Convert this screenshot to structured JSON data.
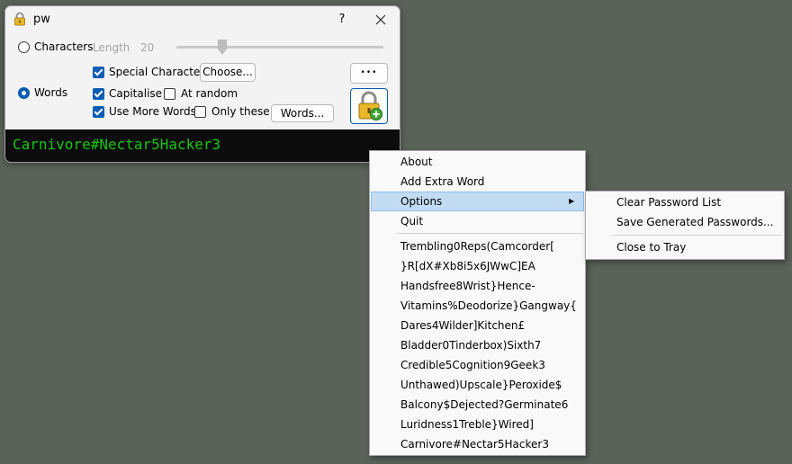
{
  "window": {
    "title": "pw",
    "help_label": "?",
    "close_label": "✕",
    "mode_characters": "Characters",
    "length_label": "Length",
    "length_value": "20",
    "special_chars": "Special Characters",
    "choose_button": "Choose...",
    "more_button": "•••",
    "mode_words": "Words",
    "capitalise": "Capitalise",
    "at_random": "At random",
    "use_more_words": "Use More Words",
    "only_these": "Only these",
    "words_button": "Words...",
    "output": "Carnivore#Nectar5Hacker3"
  },
  "state": {
    "mode": "words",
    "special_chars_checked": true,
    "capitalise_checked": true,
    "at_random_checked": false,
    "use_more_words_checked": true,
    "only_these_checked": false
  },
  "context_menu": {
    "items": [
      "About",
      "Add Extra Word",
      "Options",
      "Quit"
    ],
    "highlighted": "Options",
    "submenu_arrow": "▶",
    "history": [
      "Trembling0Reps(Camcorder[",
      "}R[dX#Xb8i5x6JWwC]EA",
      "Handsfree8Wrist}Hence-",
      "Vitamins%Deodorize}Gangway{",
      "Dares4Wilder]Kitchen£",
      "Bladder0Tinderbox)Sixth7",
      "Credible5Cognition9Geek3",
      "Unthawed)Upscale}Peroxide$",
      "Balcony$Dejected?Germinate6",
      "Luridness1Treble}Wired]",
      "Carnivore#Nectar5Hacker3"
    ]
  },
  "submenu": {
    "items": [
      "Clear Password List",
      "Save Generated Passwords...",
      "Close to Tray"
    ]
  },
  "colors": {
    "desktop": "#5a6259",
    "accent": "#0b5cb3",
    "output_text": "#16c60c",
    "highlight": "#c2dcf3"
  }
}
